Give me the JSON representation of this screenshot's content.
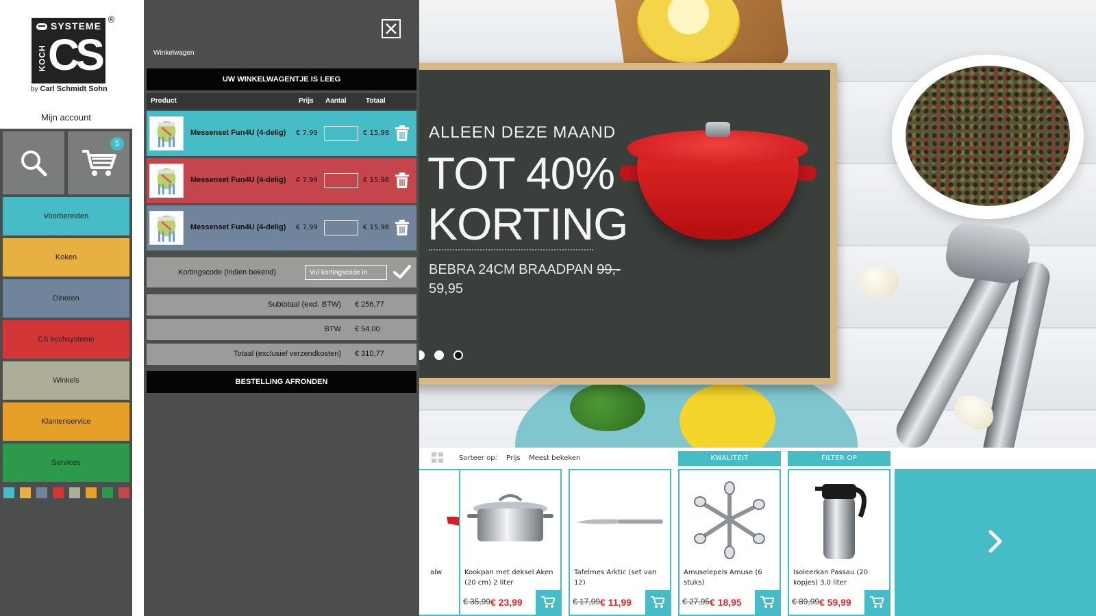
{
  "sidebar": {
    "logo": {
      "brand": "SYSTEME",
      "monogram": "CS",
      "vertical": "KOCH",
      "registered": "®",
      "byline_prefix": "by",
      "byline_name": "Carl Schmidt Sohn"
    },
    "account_label": "Mijn account",
    "cart_badge": "5",
    "nav": [
      {
        "label": "Voorbereiden",
        "color": "#46bdc6"
      },
      {
        "label": "Koken",
        "color": "#e8b040"
      },
      {
        "label": "Dineren",
        "color": "#70849c"
      },
      {
        "label": "CS kochsysteme",
        "color": "#d33636"
      },
      {
        "label": "Winkels",
        "color": "#aeae98"
      },
      {
        "label": "Klantenservice",
        "color": "#e6a027"
      },
      {
        "label": "Services",
        "color": "#2c9a4a"
      }
    ],
    "swatch_colors": [
      "#46bdc6",
      "#e8b040",
      "#70849c",
      "#d33636",
      "#aeae98",
      "#e6a027",
      "#2c9a4a",
      "#c5474f"
    ]
  },
  "cart": {
    "title": "Winkelwagen",
    "empty_banner": "UW WINKELWAGENTJE IS LEEG",
    "headers": {
      "product": "Product",
      "price": "Prijs",
      "qty": "Aantal",
      "total": "Totaal"
    },
    "items": [
      {
        "name": "Messenset Fun4U (4-delig)",
        "price": "€ 7,99",
        "qty": "",
        "total": "€ 15,98",
        "color": "#46bdc6"
      },
      {
        "name": "Messenset Fun4U (4-delig)",
        "price": "€ 7,99",
        "qty": "",
        "total": "€ 15,98",
        "color": "#c4454b"
      },
      {
        "name": "Messenset Fun4U (4-delig)",
        "price": "€ 7,99",
        "qty": "",
        "total": "€ 15,98",
        "color": "#70849c"
      }
    ],
    "coupon": {
      "label": "Kortingscode (indien bekend)",
      "placeholder": "Vul kortingscode in"
    },
    "subtotal": {
      "label": "Subtotaal (excl. BTW)",
      "value": "€ 256,77"
    },
    "vat": {
      "label": "BTW",
      "value": "€ 54,00"
    },
    "total": {
      "label": "Totaal (exclusief verzendkosten)",
      "value": "€ 310,77"
    },
    "checkout_label": "BESTELLING AFRONDEN"
  },
  "hero": {
    "line1": "ALLEEN DEZE MAAND",
    "line2": "TOT 40%",
    "line3": "KORTING",
    "sub_text": "BEBRA 24CM BRAADPAN",
    "sub_old_price": "99,-",
    "sub_new_price": "59,95",
    "slide_dots": 3,
    "active_dot": 2
  },
  "products_bar": {
    "sort_label": "Sorteer op:",
    "sort_options": [
      "Prijs",
      "Meest bekeken"
    ],
    "filter_buttons": [
      "KWALITEIT",
      "FILTER OP"
    ],
    "cards": [
      {
        "name": "alw",
        "old_price": "",
        "new_price": "",
        "img": "partial"
      },
      {
        "name": "Kookpan met deksel Aken (20 cm) 2 liter",
        "old_price": "€ 35,99",
        "new_price": "€ 23,99",
        "img": "pot"
      },
      {
        "name": "Tafelmes Arktic (set van 12)",
        "old_price": "€ 17,99",
        "new_price": "€ 11,99",
        "img": "knife"
      },
      {
        "name": "Amuselepels Amuse (6 stuks)",
        "old_price": "€ 27,95",
        "new_price": "€ 18,95",
        "img": "spoons"
      },
      {
        "name": "Isoleerkan Passau (20 kopjes) 3,0 liter",
        "old_price": "€ 89,99",
        "new_price": "€ 59,99",
        "img": "thermos"
      }
    ],
    "accent_color": "#46bdc6",
    "price_color": "#e32b2b"
  }
}
